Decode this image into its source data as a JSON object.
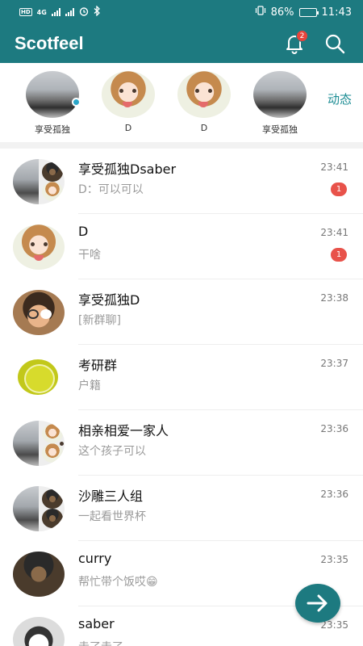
{
  "status_bar": {
    "hd_tag": "HD",
    "network": "4G",
    "battery_percent": "86%",
    "battery_level": 0.86,
    "time": "11:43"
  },
  "header": {
    "title": "Scotfeel",
    "notification_count": "2",
    "bell_icon": "bell-icon",
    "search_icon": "search-icon"
  },
  "stories": {
    "items": [
      {
        "name": "享受孤独",
        "avatar": "landscape",
        "has_dot": true
      },
      {
        "name": "D",
        "avatar": "anime"
      },
      {
        "name": "D",
        "avatar": "anime"
      },
      {
        "name": "享受孤独",
        "avatar": "landscape"
      }
    ],
    "feed_link": "动态"
  },
  "chats": [
    {
      "name": "享受孤独Dsaber",
      "preview": "D：可以可以",
      "time": "23:41",
      "unread": "1",
      "avatar": "split"
    },
    {
      "name": "D",
      "preview": "干啥",
      "time": "23:41",
      "unread": "1",
      "avatar": "anime"
    },
    {
      "name": "享受孤独D",
      "preview": "[新群聊]",
      "time": "23:38",
      "avatar": "kid"
    },
    {
      "name": "考研群",
      "preview": "户籍",
      "time": "23:37",
      "avatar": "ring"
    },
    {
      "name": "相亲相爱一家人",
      "preview": "这个孩子可以",
      "time": "23:36",
      "avatar": "split"
    },
    {
      "name": "沙雕三人组",
      "preview": "一起看世界杯",
      "time": "23:36",
      "avatar": "split"
    },
    {
      "name": "curry",
      "preview": "帮忙带个饭哎😁",
      "time": "23:35",
      "avatar": "dark"
    },
    {
      "name": "saber",
      "preview": "走了走了",
      "time": "23:35",
      "avatar": "bear"
    }
  ],
  "fab_icon": "arrow-right-icon",
  "colors": {
    "primary": "#1d7a80",
    "badge": "#e8443c",
    "link": "#1d8d94"
  }
}
